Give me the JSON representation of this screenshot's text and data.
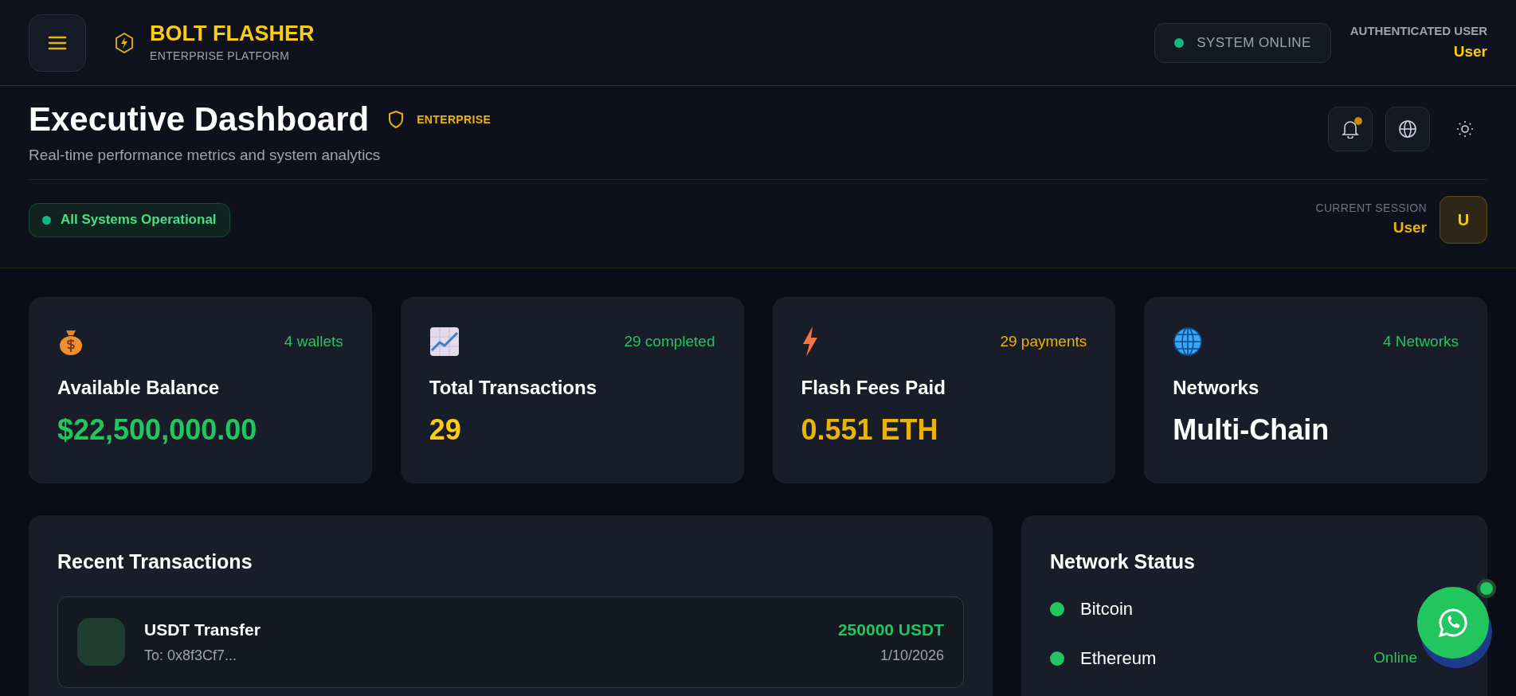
{
  "brand": {
    "title": "BOLT FLASHER",
    "subtitle": "ENTERPRISE PLATFORM"
  },
  "system_status": {
    "label": "SYSTEM ONLINE",
    "online": true
  },
  "user": {
    "caption": "AUTHENTICATED USER",
    "name": "User"
  },
  "dashboard": {
    "title": "Executive Dashboard",
    "badge": "ENTERPRISE",
    "subtitle": "Real-time performance metrics and system analytics",
    "status_pill": "All Systems Operational",
    "notifications_unread": true
  },
  "session": {
    "caption": "CURRENT SESSION",
    "name": "User",
    "avatar": "U"
  },
  "stats": [
    {
      "note": "4 wallets",
      "label": "Available Balance",
      "value": "$22,500,000.00"
    },
    {
      "note": "29 completed",
      "label": "Total Transactions",
      "value": "29"
    },
    {
      "note": "29 payments",
      "label": "Flash Fees Paid",
      "value": "0.551 ETH"
    },
    {
      "note": "4 Networks",
      "label": "Networks",
      "value": "Multi-Chain"
    }
  ],
  "recent_transactions": {
    "title": "Recent Transactions",
    "rows": [
      {
        "title": "USDT Transfer",
        "recipient": "To: 0x8f3Cf7...",
        "amount": "250000 USDT",
        "date": "1/10/2026"
      }
    ]
  },
  "network_status": {
    "title": "Network Status",
    "items": [
      {
        "name": "Bitcoin",
        "color": "#22c55e"
      },
      {
        "name": "Ethereum",
        "color": "#22c55e",
        "status": "Online"
      }
    ]
  }
}
